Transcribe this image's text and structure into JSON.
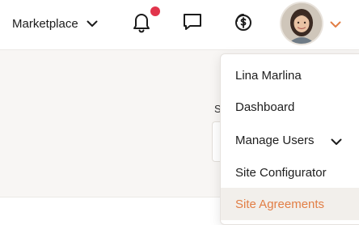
{
  "header": {
    "marketplace_label": "Marketplace",
    "notification_badge_color": "#e1344c"
  },
  "user_menu": {
    "items": [
      {
        "label": "Lina Marlina"
      },
      {
        "label": "Dashboard"
      },
      {
        "label": "Manage Users"
      },
      {
        "label": "Site Configurator"
      },
      {
        "label": "Site Agreements"
      }
    ],
    "active_color": "#e27e45"
  },
  "page": {
    "partial_label": "S"
  }
}
